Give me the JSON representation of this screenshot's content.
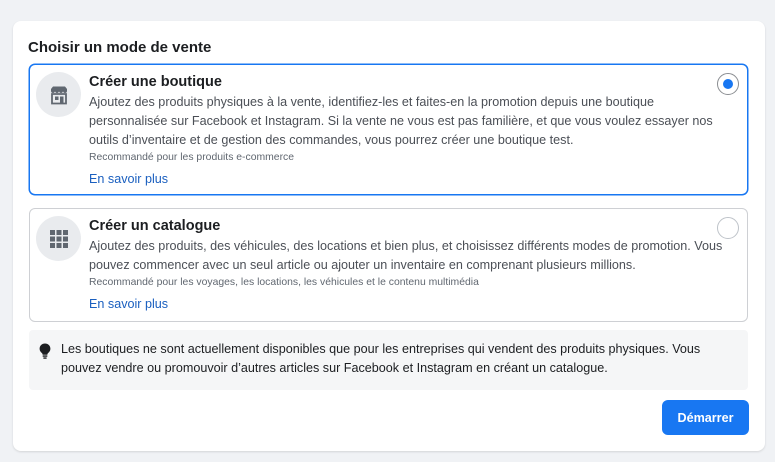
{
  "title": "Choisir un mode de vente",
  "options": [
    {
      "icon": "storefront-icon",
      "title": "Créer une boutique",
      "description": "Ajoutez des produits physiques à la vente, identifiez-les et faites-en la promotion depuis une boutique personnalisée sur Facebook et Instagram. Si la vente ne vous est pas familière, et que vous voulez essayer nos outils d’inventaire et de gestion des commandes, vous pourrez créer une boutique test.",
      "note": "Recommandé pour les produits e-commerce",
      "link": "En savoir plus",
      "selected": true
    },
    {
      "icon": "grid-icon",
      "title": "Créer un catalogue",
      "description": "Ajoutez des produits, des véhicules, des locations et bien plus, et choisissez différents modes de promotion. Vous pouvez commencer avec un seul article ou ajouter un inventaire en comprenant plusieurs millions.",
      "note": "Recommandé pour les voyages, les locations, les véhicules et le contenu multimédia",
      "link": "En savoir plus",
      "selected": false
    }
  ],
  "notice": {
    "icon": "lightbulb-icon",
    "text": "Les boutiques ne sont actuellement disponibles que pour les entreprises qui vendent des produits physiques. Vous pouvez vendre ou promouvoir d’autres articles sur Facebook et Instagram en créant un catalogue."
  },
  "start_button": "Démarrer",
  "colors": {
    "accent": "#1877f2",
    "link": "#1a5fbf"
  }
}
